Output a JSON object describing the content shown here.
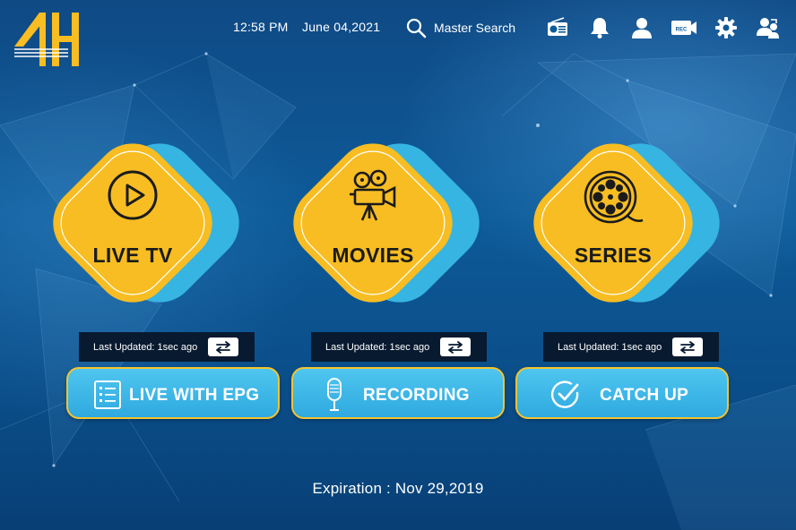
{
  "header": {
    "logo_text": "4H",
    "time": "12:58 PM",
    "date": "June 04,2021",
    "search_label": "Master Search",
    "icons": [
      "radio-icon",
      "bell-icon",
      "user-icon",
      "rec-camera-icon",
      "gear-icon",
      "switch-user-icon"
    ],
    "rec_badge": "REC"
  },
  "tiles": [
    {
      "label": "LIVE TV",
      "icon": "play-icon",
      "last_updated": "Last Updated: 1sec ago"
    },
    {
      "label": "MOVIES",
      "icon": "movie-camera-icon",
      "last_updated": "Last Updated: 1sec ago"
    },
    {
      "label": "SERIES",
      "icon": "film-reel-icon",
      "last_updated": "Last Updated: 1sec ago"
    }
  ],
  "actions": [
    {
      "label": "LIVE WITH EPG",
      "icon": "epg-list-icon"
    },
    {
      "label": "RECORDING",
      "icon": "microphone-icon"
    },
    {
      "label": "CATCH UP",
      "icon": "check-circle-icon"
    }
  ],
  "expiration": "Expiration : Nov 29,2019",
  "colors": {
    "background": "#0d5a98",
    "tile_yellow": "#f7bd22",
    "tile_cyan": "#36b5e2",
    "button_blue": "#3bb6e8",
    "button_border": "#f4c42c",
    "updated_bar": "#081a30"
  }
}
